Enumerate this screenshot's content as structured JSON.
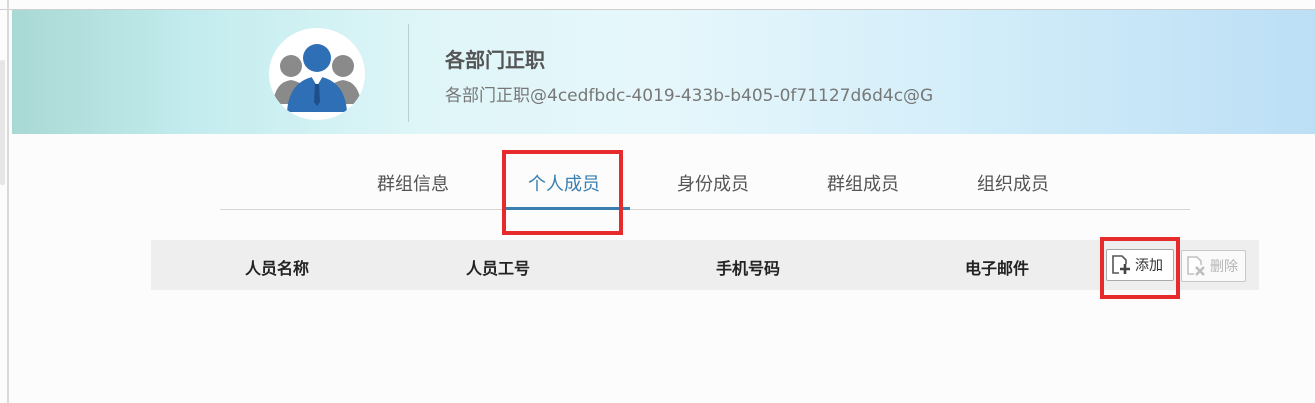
{
  "group": {
    "name": "各部门正职",
    "email": "各部门正职@4cedfbdc-4019-433b-b405-0f71127d6d4c@G"
  },
  "tabs": [
    {
      "label": "群组信息",
      "active": false
    },
    {
      "label": "个人成员",
      "active": true
    },
    {
      "label": "身份成员",
      "active": false
    },
    {
      "label": "群组成员",
      "active": false
    },
    {
      "label": "组织成员",
      "active": false
    }
  ],
  "table": {
    "columns": [
      "人员名称",
      "人员工号",
      "手机号码",
      "电子邮件"
    ]
  },
  "actions": {
    "add_label": "添加",
    "add_icon": "add-document-icon",
    "delete_label": "删除",
    "delete_icon": "delete-document-icon",
    "delete_enabled": false
  },
  "colors": {
    "accent": "#3a7fb0",
    "highlight": "#e52b2b",
    "header_bg": "#eeeeee",
    "avatar_blue": "#2f6fb5",
    "avatar_gray": "#8a8a8a"
  }
}
